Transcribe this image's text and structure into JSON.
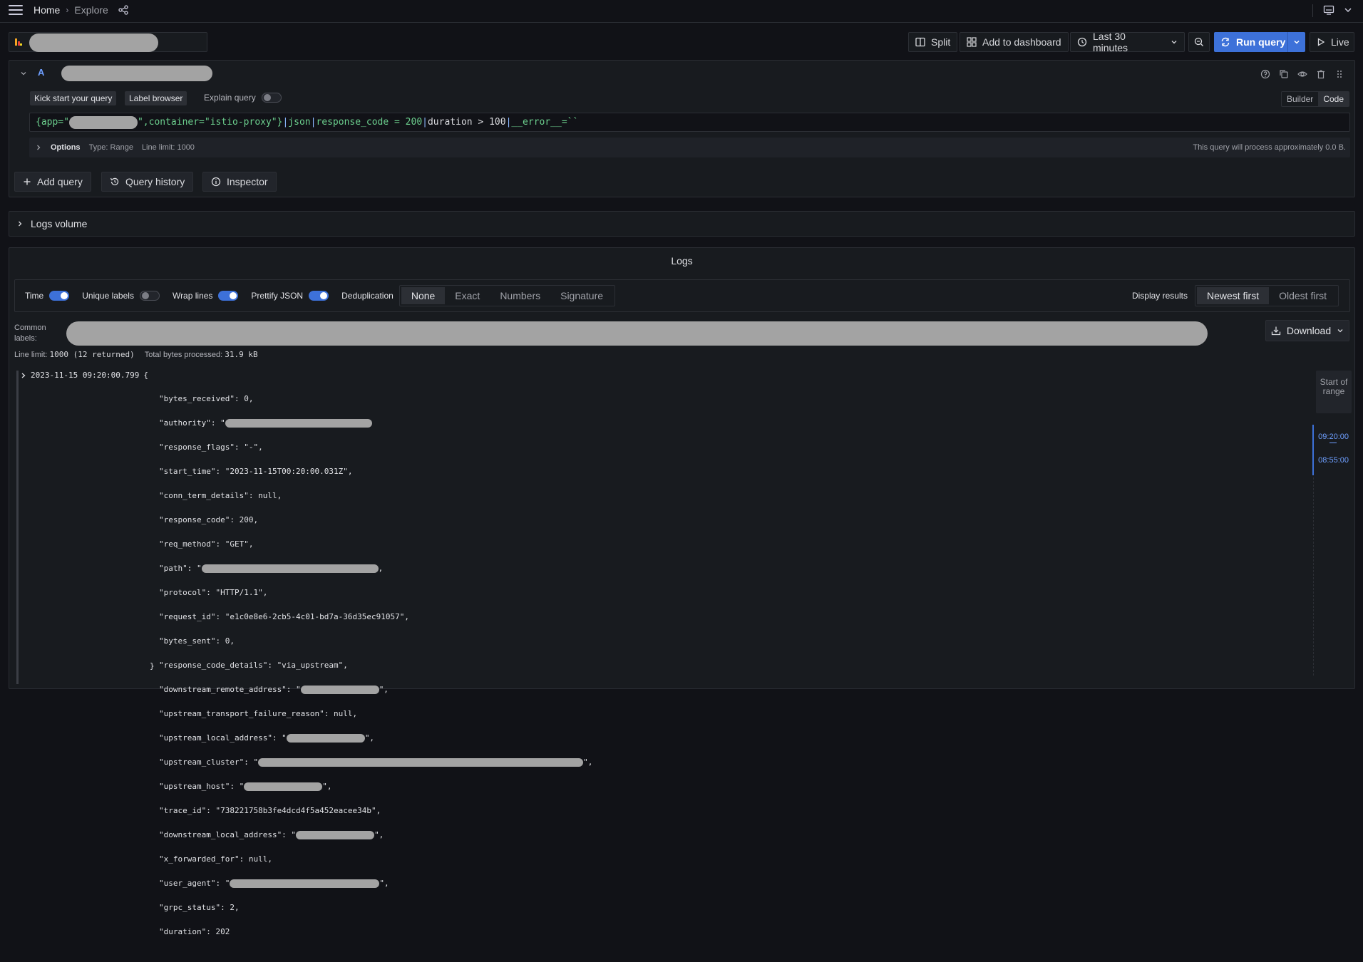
{
  "nav": {
    "home": "Home",
    "explore": "Explore"
  },
  "toolbar": {
    "split": "Split",
    "add_to_dashboard": "Add to dashboard",
    "time_range": "Last 30 minutes",
    "run_query": "Run query",
    "live": "Live"
  },
  "query": {
    "letter": "A",
    "kick_start": "Kick start your query",
    "label_browser": "Label browser",
    "explain_query": "Explain query",
    "mode_builder": "Builder",
    "mode_code": "Code",
    "expr_prefix": "{app=\"",
    "expr_mid": "\",container=\"istio-proxy\"}",
    "expr_pipe1": "|",
    "expr_json": "json",
    "expr_pipe2": "|",
    "expr_cond1": "response_code = 200",
    "expr_pipe3": "|",
    "expr_cond2": "duration > 100",
    "expr_pipe4": "|",
    "expr_error": "__error__=``",
    "options_label": "Options",
    "options_type": "Type: Range",
    "options_limit": "Line limit: 1000",
    "process_note": "This query will process approximately 0.0 B.",
    "add_query": "Add query",
    "query_history": "Query history",
    "inspector": "Inspector"
  },
  "volume": {
    "label": "Logs volume"
  },
  "logs": {
    "title": "Logs",
    "time": "Time",
    "unique_labels": "Unique labels",
    "wrap_lines": "Wrap lines",
    "prettify_json": "Prettify JSON",
    "deduplication": "Deduplication",
    "dedup_options": [
      "None",
      "Exact",
      "Numbers",
      "Signature"
    ],
    "display_results": "Display results",
    "newest_first": "Newest first",
    "oldest_first": "Oldest first",
    "common_labels_1": "Common",
    "common_labels_2": "labels:",
    "download": "Download",
    "line_limit_label": "Line limit:",
    "line_limit_value": "1000 (12 returned)",
    "bytes_label": "Total bytes processed:",
    "bytes_value": "31.9 kB",
    "timestamp": "2023-11-15 09:20:00.799",
    "open_brace": "{",
    "close_brace": "}",
    "json_lines": [
      "\"bytes_received\": 0,",
      "\"authority\": \"",
      "\"response_flags\": \"-\",",
      "\"start_time\": \"2023-11-15T00:20:00.031Z\",",
      "\"conn_term_details\": null,",
      "\"response_code\": 200,",
      "\"req_method\": \"GET\",",
      "\"path\": \"",
      "\"protocol\": \"HTTP/1.1\",",
      "\"request_id\": \"e1c0e8e6-2cb5-4c01-bd7a-36d35ec91057\",",
      "\"bytes_sent\": 0,",
      "\"response_code_details\": \"via_upstream\",",
      "\"downstream_remote_address\": \"",
      "\"upstream_transport_failure_reason\": null,",
      "\"upstream_local_address\": \"",
      "\"upstream_cluster\": \"",
      "\"upstream_host\": \"",
      "\"trace_id\": \"738221758b3fe4dcd4f5a452eacee34b\",",
      "\"downstream_local_address\": \"",
      "\"x_forwarded_for\": null,",
      "\"user_agent\": \"",
      "\"grpc_status\": 2,",
      "\"duration\": 202"
    ],
    "range_label": "Start of range",
    "range_start": "09:20:00",
    "range_end": "08:55:00"
  }
}
